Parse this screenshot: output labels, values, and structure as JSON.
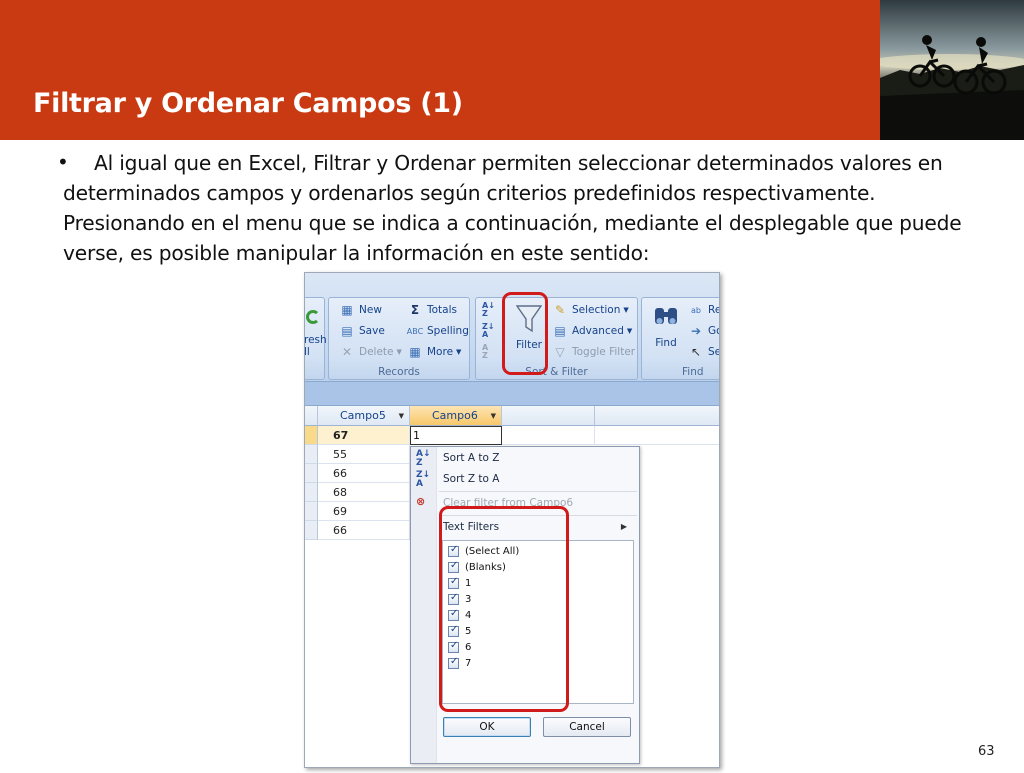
{
  "slide": {
    "title": "Filtrar y Ordenar Campos (1)",
    "page_number": "63",
    "accent_color": "#c93a12"
  },
  "body": {
    "bullet": "•",
    "text": "Al igual que en Excel, Filtrar y Ordenar permiten seleccionar determinados valores en determinados campos y ordenarlos según criterios predefinidos respectivamente. Presionando en el menu que se indica a continuación, mediante el desplegable que puede verse, es posible manipular la información en este sentido:"
  },
  "ribbon": {
    "refresh_partial": "resh",
    "refresh_partial2": "ll",
    "records": {
      "label": "Records",
      "new": "New",
      "save": "Save",
      "delete": "Delete",
      "totals": "Totals",
      "spelling": "Spelling",
      "more": "More"
    },
    "sort_filter": {
      "label": "Sort & Filter",
      "filter": "Filter",
      "selection": "Selection",
      "advanced": "Advanced",
      "toggle_filter": "Toggle Filter"
    },
    "find": {
      "label": "Find",
      "find": "Find",
      "replace_partial": "Re",
      "goto_partial": "Go",
      "select_partial": "Sel"
    }
  },
  "datasheet": {
    "columns": [
      "Campo5",
      "Campo6"
    ],
    "campo5_values": [
      "67",
      "55",
      "66",
      "68",
      "69",
      "66"
    ],
    "edit_value": "1"
  },
  "filter_menu": {
    "sort_asc": "Sort A to Z",
    "sort_desc": "Sort Z to A",
    "clear_filter": "Clear filter from Campo6",
    "text_filters": "Text Filters",
    "items": [
      "(Select All)",
      "(Blanks)",
      "1",
      "3",
      "4",
      "5",
      "6",
      "7"
    ],
    "ok": "OK",
    "cancel": "Cancel"
  },
  "icons": {
    "filter": "funnel-icon",
    "sort_asc": "sort-az-icon",
    "sort_desc": "sort-za-icon",
    "clear": "clear-filter-icon",
    "find": "binoculars-icon"
  },
  "highlight_color": "#d11a1a"
}
